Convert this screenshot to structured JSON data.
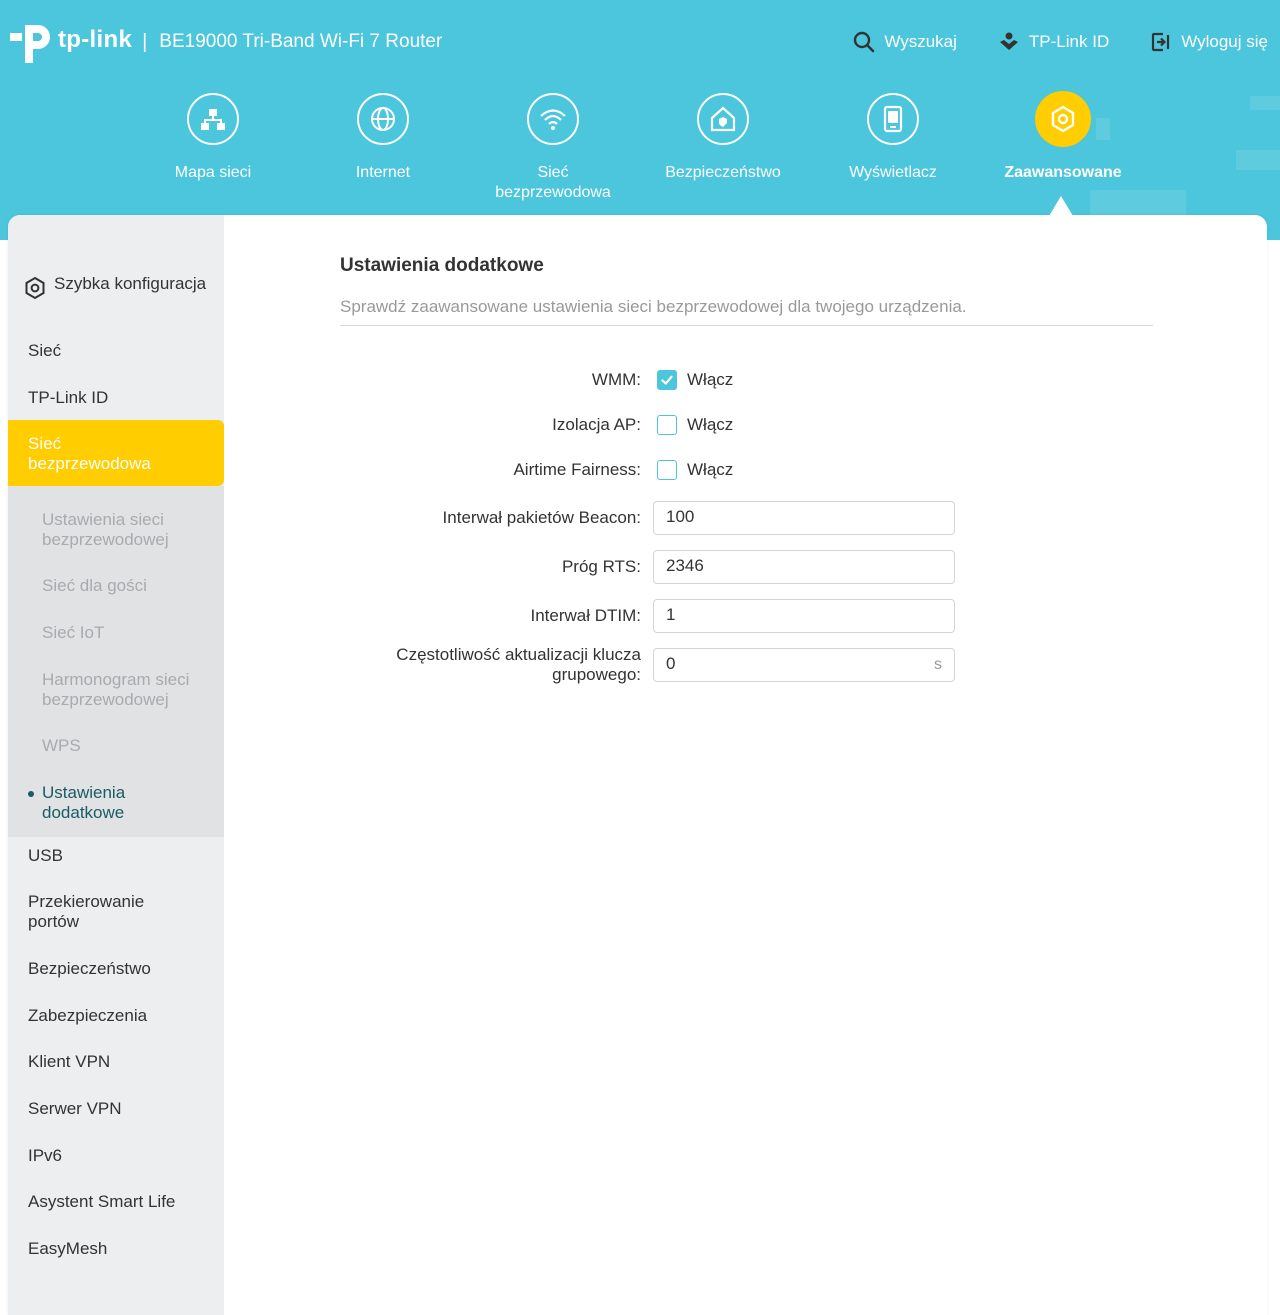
{
  "header": {
    "logo_text": "tp-link",
    "model": "BE19000 Tri-Band Wi-Fi 7 Router",
    "actions": [
      {
        "label": "Wyszukaj",
        "icon": "search-icon"
      },
      {
        "label": "TP-Link ID",
        "icon": "tplink-id-icon"
      },
      {
        "label": "Wyloguj się",
        "icon": "logout-icon"
      }
    ],
    "background_color": "#4cc6dc",
    "accent_color": "#ffcd00"
  },
  "nav": {
    "items": [
      {
        "label": "Mapa sieci",
        "icon": "network-map-icon"
      },
      {
        "label": "Internet",
        "icon": "globe-icon"
      },
      {
        "label": "Sieć bezprzewodowa",
        "icon": "wifi-icon"
      },
      {
        "label": "Bezpieczeństwo",
        "icon": "home-shield-icon"
      },
      {
        "label": "Wyświetlacz",
        "icon": "display-icon"
      },
      {
        "label": "Zaawansowane",
        "icon": "gear-icon",
        "active": true
      }
    ]
  },
  "sidebar": {
    "items": [
      {
        "label": "Szybka konfiguracja",
        "icon": "gear-icon"
      },
      {
        "label": "Sieć"
      },
      {
        "label": "TP-Link ID"
      },
      {
        "label": "Sieć bezprzewodowa",
        "active": true
      },
      {
        "label": "USB"
      },
      {
        "label": "Przekierowanie portów"
      },
      {
        "label": "Bezpieczeństwo"
      },
      {
        "label": "Zabezpieczenia"
      },
      {
        "label": "Klient VPN"
      },
      {
        "label": "Serwer VPN"
      },
      {
        "label": "IPv6"
      },
      {
        "label": "Asystent Smart Life"
      },
      {
        "label": "EasyMesh"
      }
    ],
    "submenu": [
      {
        "label": "Ustawienia sieci bezprzewodowej"
      },
      {
        "label": "Sieć dla gości"
      },
      {
        "label": "Sieć IoT"
      },
      {
        "label": "Harmonogram sieci bezprzewodowej"
      },
      {
        "label": "WPS"
      },
      {
        "label": "Ustawienia dodatkowe",
        "current": true
      }
    ]
  },
  "main": {
    "title": "Ustawienia dodatkowe",
    "description": "Sprawdź zaawansowane ustawienia sieci bezprzewodowej dla twojego urządzenia.",
    "checkboxes": [
      {
        "label": "WMM:",
        "option": "Włącz",
        "checked": true
      },
      {
        "label": "Izolacja AP:",
        "option": "Włącz",
        "checked": false
      },
      {
        "label": "Airtime Fairness:",
        "option": "Włącz",
        "checked": false
      }
    ],
    "fields": [
      {
        "label": "Interwał pakietów Beacon:",
        "value": "100"
      },
      {
        "label": "Próg RTS:",
        "value": "2346"
      },
      {
        "label": "Interwał DTIM:",
        "value": "1"
      },
      {
        "label_line1": "Częstotliwość aktualizacji klucza",
        "label_line2": "grupowego:",
        "value": "0",
        "unit": "s"
      }
    ]
  }
}
